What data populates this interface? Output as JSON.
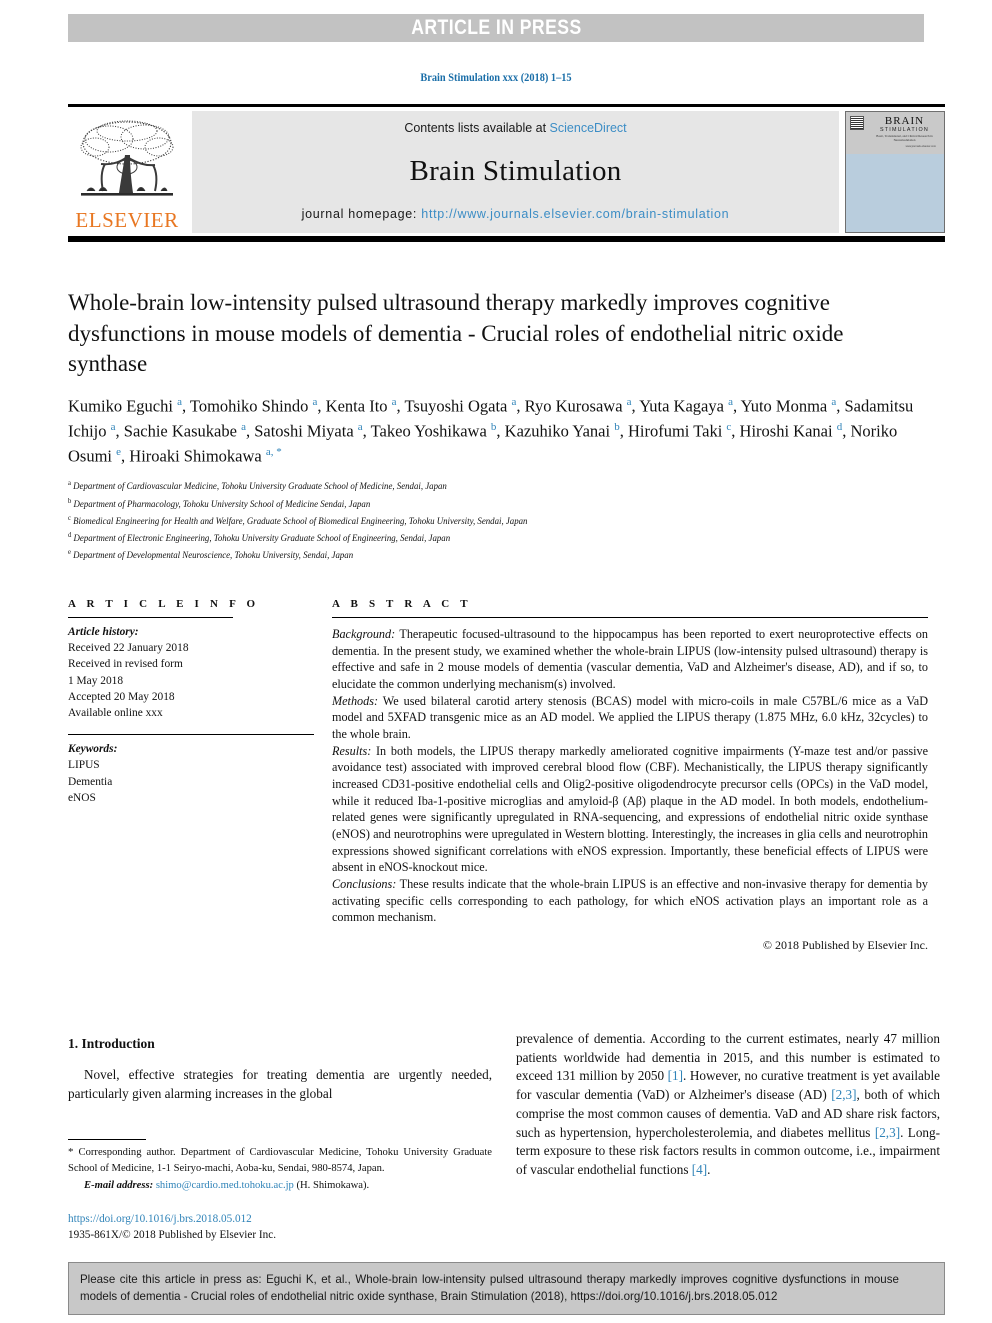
{
  "banner": {
    "label": "ARTICLE IN PRESS"
  },
  "running_head": {
    "text": "Brain Stimulation xxx (2018) 1–15"
  },
  "masthead": {
    "contents_prefix": "Contents lists available at ",
    "contents_link": "ScienceDirect",
    "journal_name": "Brain Stimulation",
    "homepage_label": "journal homepage:",
    "homepage_url": "http://www.journals.elsevier.com/brain-stimulation",
    "publisher_logo_text": "ELSEVIER",
    "publisher_logo_icon": "elsevier-tree-icon",
    "cover": {
      "title_line1": "BRAIN",
      "title_line2": "STIMULATION",
      "title_line3": "Basic, Translational, and Clinical Research in Neuromodulation",
      "title_line4": "www.journals.elsevier.com"
    }
  },
  "article": {
    "title": "Whole-brain low-intensity pulsed ultrasound therapy markedly improves cognitive dysfunctions in mouse models of dementia - Crucial roles of endothelial nitric oxide synthase",
    "authors": [
      {
        "name": "Kumiko Eguchi",
        "mark": "a"
      },
      {
        "name": "Tomohiko Shindo",
        "mark": "a"
      },
      {
        "name": "Kenta Ito",
        "mark": "a"
      },
      {
        "name": "Tsuyoshi Ogata",
        "mark": "a"
      },
      {
        "name": "Ryo Kurosawa",
        "mark": "a"
      },
      {
        "name": "Yuta Kagaya",
        "mark": "a"
      },
      {
        "name": "Yuto Monma",
        "mark": "a"
      },
      {
        "name": "Sadamitsu Ichijo",
        "mark": "a"
      },
      {
        "name": "Sachie Kasukabe",
        "mark": "a"
      },
      {
        "name": "Satoshi Miyata",
        "mark": "a"
      },
      {
        "name": "Takeo Yoshikawa",
        "mark": "b"
      },
      {
        "name": "Kazuhiko Yanai",
        "mark": "b"
      },
      {
        "name": "Hirofumi Taki",
        "mark": "c"
      },
      {
        "name": "Hiroshi Kanai",
        "mark": "d"
      },
      {
        "name": "Noriko Osumi",
        "mark": "e"
      },
      {
        "name": "Hiroaki Shimokawa",
        "mark": "a, *"
      }
    ],
    "affiliations": [
      {
        "mark": "a",
        "text": "Department of Cardiovascular Medicine, Tohoku University Graduate School of Medicine, Sendai, Japan"
      },
      {
        "mark": "b",
        "text": "Department of Pharmacology, Tohoku University School of Medicine Sendai, Japan"
      },
      {
        "mark": "c",
        "text": "Biomedical Engineering for Health and Welfare, Graduate School of Biomedical Engineering, Tohoku University, Sendai, Japan"
      },
      {
        "mark": "d",
        "text": "Department of Electronic Engineering, Tohoku University Graduate School of Engineering, Sendai, Japan"
      },
      {
        "mark": "e",
        "text": "Department of Developmental Neuroscience, Tohoku University, Sendai, Japan"
      }
    ]
  },
  "article_info": {
    "heading": "A R T I C L E  I N F O",
    "history_label": "Article history:",
    "history": [
      "Received 22 January 2018",
      "Received in revised form",
      "1 May 2018",
      "Accepted 20 May 2018",
      "Available online xxx"
    ],
    "keywords_label": "Keywords:",
    "keywords": [
      "LIPUS",
      "Dementia",
      "eNOS"
    ]
  },
  "abstract": {
    "heading": "A B S T R A C T",
    "background_label": "Background:",
    "background": " Therapeutic focused-ultrasound to the hippocampus has been reported to exert neuroprotective effects on dementia. In the present study, we examined whether the whole-brain LIPUS (low-intensity pulsed ultrasound) therapy is effective and safe in 2 mouse models of dementia (vascular dementia, VaD and Alzheimer's disease, AD), and if so, to elucidate the common underlying mechanism(s) involved.",
    "methods_label": "Methods:",
    "methods": " We used bilateral carotid artery stenosis (BCAS) model with micro-coils in male C57BL/6 mice as a VaD model and 5XFAD transgenic mice as an AD model. We applied the LIPUS therapy (1.875 MHz, 6.0 kHz, 32cycles) to the whole brain.",
    "results_label": "Results:",
    "results": " In both models, the LIPUS therapy markedly ameliorated cognitive impairments (Y-maze test and/or passive avoidance test) associated with improved cerebral blood flow (CBF). Mechanistically, the LIPUS therapy significantly increased CD31-positive endothelial cells and Olig2-positive oligodendrocyte precursor cells (OPCs) in the VaD model, while it reduced Iba-1-positive microglias and amyloid-β (Aβ) plaque in the AD model. In both models, endothelium-related genes were significantly upregulated in RNA-sequencing, and expressions of endothelial nitric oxide synthase (eNOS) and neurotrophins were upregulated in Western blotting. Interestingly, the increases in glia cells and neurotrophin expressions showed significant correlations with eNOS expression. Importantly, these beneficial effects of LIPUS were absent in eNOS-knockout mice.",
    "conclusions_label": "Conclusions:",
    "conclusions": " These results indicate that the whole-brain LIPUS is an effective and non-invasive therapy for dementia by activating specific cells corresponding to each pathology, for which eNOS activation plays an important role as a common mechanism.",
    "copyright": "© 2018 Published by Elsevier Inc."
  },
  "introduction": {
    "heading": "1. Introduction",
    "left_para": "Novel, effective strategies for treating dementia are urgently needed, particularly given alarming increases in the global",
    "right_para_1": "prevalence of dementia. According to the current estimates, nearly 47 million patients worldwide had dementia in 2015, and this number is estimated to exceed 131 million by 2050 ",
    "right_ref_1": "[1]",
    "right_para_2": ". However, no curative treatment is yet available for vascular dementia (VaD) or Alzheimer's disease (AD) ",
    "right_ref_2": "[2,3]",
    "right_para_3": ", both of which comprise the most common causes of dementia. VaD and AD share risk factors, such as hypertension, hypercholesterolemia, and diabetes mellitus ",
    "right_ref_3": "[2,3]",
    "right_para_4": ". Long-term exposure to these risk factors results in common outcome, i.e., impairment of vascular endothelial functions ",
    "right_ref_4": "[4]",
    "right_para_5": "."
  },
  "footnote": {
    "star": "*",
    "corresponding": " Corresponding author. Department of Cardiovascular Medicine, Tohoku University Graduate School of Medicine, 1-1 Seiryo-machi, Aoba-ku, Sendai, 980-8574, Japan.",
    "email_label": "E-mail address:",
    "email": "shimo@cardio.med.tohoku.ac.jp",
    "email_suffix": " (H. Shimokawa)."
  },
  "doi_block": {
    "doi_url": "https://doi.org/10.1016/j.brs.2018.05.012",
    "issn_line": "1935-861X/© 2018 Published by Elsevier Inc."
  },
  "cite_box": {
    "text": "Please cite this article in press as: Eguchi K, et al., Whole-brain low-intensity pulsed ultrasound therapy markedly improves cognitive dysfunctions in mouse models of dementia - Crucial roles of endothelial nitric oxide synthase, Brain Stimulation (2018), https://doi.org/10.1016/j.brs.2018.05.012"
  },
  "colors": {
    "link_blue": "#2f83b8",
    "sciencedirect_blue": "#3c8dc5",
    "elsevier_orange": "#e87722",
    "banner_grey": "#c2c2c2",
    "masthead_grey": "#e6e6e6",
    "cover_blue": "#b9cddd",
    "cite_box_grey": "#c8c8c8"
  }
}
